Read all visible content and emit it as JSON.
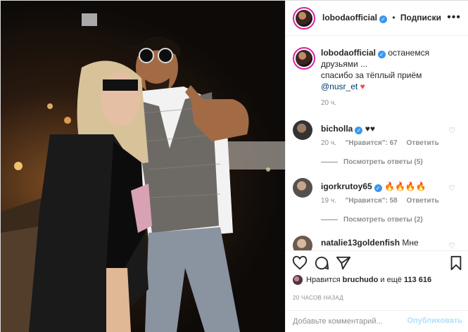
{
  "post_author": {
    "username": "lobodaofficial",
    "follow_label": "Подписки",
    "separator": "•"
  },
  "caption": {
    "username": "lobodaofficial",
    "text_line1": "останемся",
    "text_line2": "друзьями ...",
    "text_line3": "спасибо за тёплый приём",
    "mention": "@nusr_et",
    "heart": "♥",
    "time": "20 ч."
  },
  "comments": [
    {
      "username": "bicholla",
      "text": "♥♥",
      "time": "20 ч.",
      "likes": "\"Нравится\": 67",
      "reply": "Ответить",
      "view_replies": "Посмотреть ответы (5)"
    },
    {
      "username": "igorkrutoy65",
      "text": "🔥🔥🔥🔥",
      "time": "19 ч.",
      "likes": "\"Нравится\": 58",
      "reply": "Ответить",
      "view_replies": "Посмотреть ответы (2)"
    },
    {
      "username": "natalie13goldenfish",
      "text": "Мне"
    }
  ],
  "likes_line": {
    "prefix": "Нравится",
    "user": "bruchudo",
    "middle": "и ещё",
    "count": "113 616"
  },
  "timeago": "20 ЧАСОВ НАЗАД",
  "comment_input": {
    "placeholder": "Добавьте комментарий...",
    "value": ""
  },
  "publish_label": "Опубликовать",
  "colors": {
    "accent": "#3897f0",
    "publish_disabled": "#b2dffc",
    "muted": "#8e8e8e",
    "like_red": "#ed4956"
  },
  "icons": [
    "more-icon",
    "heart-icon",
    "comment-icon",
    "share-icon",
    "bookmark-icon",
    "verified-icon"
  ]
}
